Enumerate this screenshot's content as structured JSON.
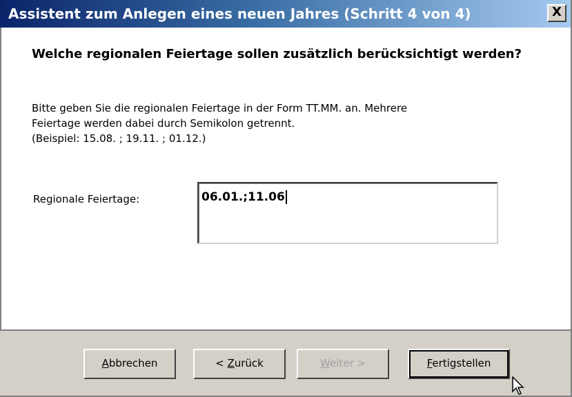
{
  "window": {
    "title": "Assistent zum Anlegen eines neuen Jahres (Schritt 4 von 4)",
    "close_label": "X"
  },
  "content": {
    "heading": "Welche regionalen Feiertage sollen zusätzlich berücksichtigt werden?",
    "description_lines": [
      "Bitte geben Sie die regionalen Feiertage in der Form TT.MM. an. Mehrere",
      "Feiertage werden dabei durch Semikolon getrennt.",
      "(Beispiel: 15.08. ; 19.11. ; 01.12.)"
    ],
    "field_label": "Regionale Feiertage:",
    "field_value": "06.01.;11.06"
  },
  "buttons": {
    "cancel": {
      "mnemonic": "A",
      "rest": "bbrechen"
    },
    "back": {
      "prefix": "< ",
      "mnemonic": "Z",
      "rest": "urück"
    },
    "next": {
      "mnemonic": "W",
      "rest": "eiter >"
    },
    "finish": {
      "mnemonic": "F",
      "rest": "ertigstellen"
    }
  },
  "colors": {
    "titlebar_start": "#0a246a",
    "titlebar_end": "#a6caf0",
    "face": "#d4d0c8"
  },
  "icons": [
    "close-icon",
    "mouse-cursor-icon"
  ]
}
